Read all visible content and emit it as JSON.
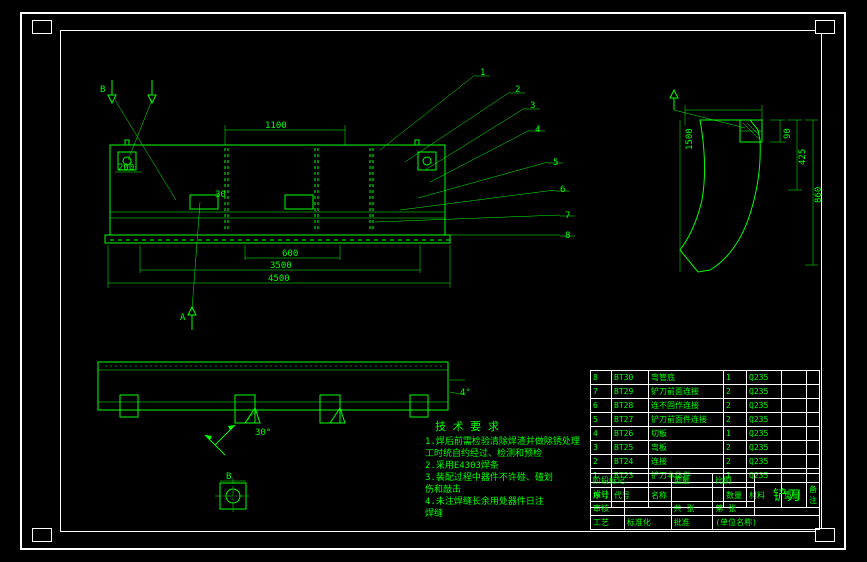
{
  "drawing": {
    "title": "铲刀",
    "tech_req_heading": "技 术 要 求",
    "tech_req_lines": [
      "1.焊后前需检验清除焊渣并做除锈处理",
      "工时统自约经过、检测和预检",
      "2.采用E4303焊条",
      "3.装配过程中器件不许碰、磕划",
      "伤和敲击",
      "4.未注焊缝长余用处器件日注",
      "焊缝"
    ]
  },
  "dimensions": {
    "d1100": "1100",
    "d200": "200",
    "d30": "30",
    "d600": "600",
    "d3500": "3500",
    "d4500": "4500",
    "d90": "90",
    "d425": "425",
    "d860": "860",
    "d1500": "1500",
    "angle30": "30°",
    "angle4": "4°",
    "numbers": [
      "1",
      "2",
      "3",
      "4",
      "5",
      "6",
      "7",
      "8"
    ],
    "section_a": "A",
    "section_b": "B"
  },
  "bom": {
    "rows": [
      {
        "no": "8",
        "code": "BT30",
        "name": "弯管底",
        "qty": "1",
        "mat": "Q235"
      },
      {
        "no": "7",
        "code": "BT29",
        "name": "铲刀前面连接",
        "qty": "2",
        "mat": "Q235"
      },
      {
        "no": "6",
        "code": "BT28",
        "name": "连不固作连接",
        "qty": "2",
        "mat": "Q235"
      },
      {
        "no": "5",
        "code": "BT27",
        "name": "铲刀前面件连接",
        "qty": "2",
        "mat": "Q235"
      },
      {
        "no": "4",
        "code": "BT26",
        "name": "切板",
        "qty": "1",
        "mat": "Q235"
      },
      {
        "no": "3",
        "code": "BT25",
        "name": "弯板",
        "qty": "2",
        "mat": "Q235"
      },
      {
        "no": "2",
        "code": "BT24",
        "name": "连接",
        "qty": "2",
        "mat": "Q235"
      },
      {
        "no": "1",
        "code": "BT23",
        "name": "铲刀本体件",
        "qty": "1",
        "mat": "Q235"
      }
    ],
    "headers": {
      "no": "序号",
      "code": "代号",
      "name": "名称",
      "qty": "数量",
      "mat": "材料",
      "wt": "重量",
      "note": "备注"
    }
  },
  "titleblock": {
    "drawn": "设计",
    "check": "审核",
    "appr": "批准",
    "std": "标准化",
    "proc": "工艺",
    "scale": "比例",
    "sheet": "共 张",
    "sheetof": "第 张",
    "stage": "阶段标记",
    "mass": "重量",
    "dept": "(单位名称)"
  }
}
